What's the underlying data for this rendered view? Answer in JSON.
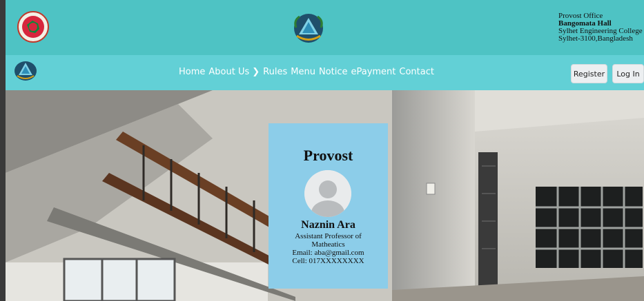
{
  "header": {
    "office_title": "Provost Office",
    "hall_name": "Bangomata Hall",
    "college": "Sylhet Engineering College",
    "address": "Sylhet-3100,Bangladesh"
  },
  "nav": {
    "items": [
      "Home",
      "About Us",
      "Rules",
      "Menu",
      "Notice",
      "ePayment",
      "Contact"
    ],
    "register_label": "Register",
    "login_label": "Log In"
  },
  "provost_card": {
    "title": "Provost",
    "name": "Naznin Ara",
    "designation": "Assistant Professor of Matheatics",
    "email": "Email: aba@gmail.com",
    "cell": "Cell: 017XXXXXXXX"
  },
  "colors": {
    "topbar": "#4ec3c4",
    "navbar": "#62d0d6",
    "card": "#8ccde9"
  }
}
